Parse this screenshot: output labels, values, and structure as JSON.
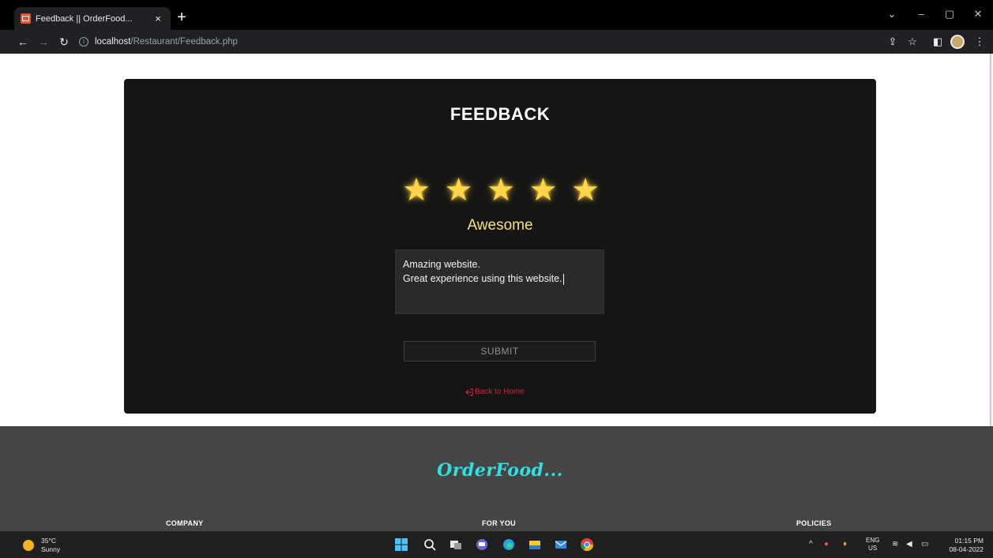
{
  "browser": {
    "tab_title": "Feedback || OrderFood...",
    "tab_close": "×",
    "new_tab": "+",
    "url_host": "localhost",
    "url_path": "/Restaurant/Feedback.php",
    "window_controls": {
      "chevron": "⌄",
      "minimize": "–",
      "maximize": "▢",
      "close": "✕"
    }
  },
  "feedback": {
    "title": "FEEDBACK",
    "rating_stars": 5,
    "rating_max": 5,
    "rating_label": "Awesome",
    "text_line1": "Amazing website.",
    "text_line2": "Great experience using this website.",
    "submit_label": "SUBMIT",
    "back_link": "Back to Home"
  },
  "footer": {
    "brand": "OrderFood...",
    "headings": [
      "COMPANY",
      "FOR YOU",
      "POLICIES"
    ]
  },
  "taskbar": {
    "temperature": "35°C",
    "condition": "Sunny",
    "lang_top": "ENG",
    "lang_bottom": "US",
    "time": "01:15 PM",
    "date": "08-04-2022"
  },
  "colors": {
    "card_bg": "#151515",
    "star": "#ffd54a",
    "rating_label": "#f5e27a",
    "back_link": "#d3213d",
    "footer_bg": "#454545",
    "brand": "#2ee0e0"
  },
  "icons": {
    "back": "back-arrow-icon",
    "forward": "forward-arrow-icon",
    "reload": "reload-icon",
    "site_info": "info-icon",
    "share": "share-icon",
    "bookmark": "star-bookmark-icon",
    "sidebar": "side-panel-icon",
    "menu": "kebab-menu-icon"
  }
}
